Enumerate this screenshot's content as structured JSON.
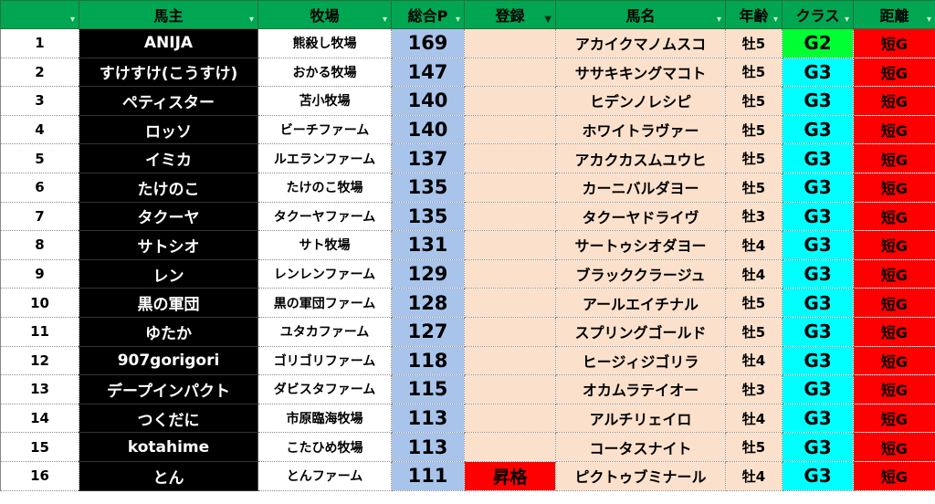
{
  "headers": [
    "",
    "馬主",
    "牧場",
    "総合P",
    "登録",
    "馬名",
    "年齢",
    "クラス",
    "距離"
  ],
  "filter_icon": "▾",
  "filter_active_icon": "▼",
  "rows": [
    {
      "no": "1",
      "owner": "ANIJA",
      "farm": "熊殺し牧場",
      "points": "169",
      "reg": "",
      "horse": "アカイクマノムスコ",
      "age": "牡5",
      "cls": "G2",
      "dist": "短G"
    },
    {
      "no": "2",
      "owner": "すけすけ(こうすけ)",
      "farm": "おかる牧場",
      "points": "147",
      "reg": "",
      "horse": "ササキキングマコト",
      "age": "牡5",
      "cls": "G3",
      "dist": "短G"
    },
    {
      "no": "3",
      "owner": "ペティスター",
      "farm": "苫小牧場",
      "points": "140",
      "reg": "",
      "horse": "ヒデンノレシピ",
      "age": "牡5",
      "cls": "G3",
      "dist": "短G"
    },
    {
      "no": "4",
      "owner": "ロッソ",
      "farm": "ビーチファーム",
      "points": "140",
      "reg": "",
      "horse": "ホワイトラヴァー",
      "age": "牡5",
      "cls": "G3",
      "dist": "短G"
    },
    {
      "no": "5",
      "owner": "イミカ",
      "farm": "ルエランファーム",
      "points": "137",
      "reg": "",
      "horse": "アカクカスムユウヒ",
      "age": "牡5",
      "cls": "G3",
      "dist": "短G"
    },
    {
      "no": "6",
      "owner": "たけのこ",
      "farm": "たけのこ牧場",
      "points": "135",
      "reg": "",
      "horse": "カーニバルダヨー",
      "age": "牡5",
      "cls": "G3",
      "dist": "短G"
    },
    {
      "no": "7",
      "owner": "タクーヤ",
      "farm": "タクーヤファーム",
      "points": "135",
      "reg": "",
      "horse": "タクーヤドライヴ",
      "age": "牡3",
      "cls": "G3",
      "dist": "短G"
    },
    {
      "no": "8",
      "owner": "サトシオ",
      "farm": "サト牧場",
      "points": "131",
      "reg": "",
      "horse": "サートゥシオダヨー",
      "age": "牡4",
      "cls": "G3",
      "dist": "短G"
    },
    {
      "no": "9",
      "owner": "レン",
      "farm": "レンレンファーム",
      "points": "129",
      "reg": "",
      "horse": "ブラッククラージュ",
      "age": "牡4",
      "cls": "G3",
      "dist": "短G"
    },
    {
      "no": "10",
      "owner": "黒の軍団",
      "farm": "黒の軍団ファーム",
      "points": "128",
      "reg": "",
      "horse": "アールエイチナル",
      "age": "牡5",
      "cls": "G3",
      "dist": "短G"
    },
    {
      "no": "11",
      "owner": "ゆたか",
      "farm": "ユタカファーム",
      "points": "127",
      "reg": "",
      "horse": "スプリングゴールド",
      "age": "牡5",
      "cls": "G3",
      "dist": "短G"
    },
    {
      "no": "12",
      "owner": "907gorigori",
      "farm": "ゴリゴリファーム",
      "points": "118",
      "reg": "",
      "horse": "ヒージィジゴリラ",
      "age": "牡4",
      "cls": "G3",
      "dist": "短G"
    },
    {
      "no": "13",
      "owner": "デープインパクト",
      "farm": "ダビスタファーム",
      "points": "115",
      "reg": "",
      "horse": "オカムラテイオー",
      "age": "牡3",
      "cls": "G3",
      "dist": "短G"
    },
    {
      "no": "14",
      "owner": "つくだに",
      "farm": "市原臨海牧場",
      "points": "113",
      "reg": "",
      "horse": "アルチリェイロ",
      "age": "牡4",
      "cls": "G3",
      "dist": "短G"
    },
    {
      "no": "15",
      "owner": "kotahime",
      "farm": "こたひめ牧場",
      "points": "113",
      "reg": "",
      "horse": "コータスナイト",
      "age": "牡5",
      "cls": "G3",
      "dist": "短G"
    },
    {
      "no": "16",
      "owner": "とん",
      "farm": "とんファーム",
      "points": "111",
      "reg": "昇格",
      "horse": "ピクトゥブミナール",
      "age": "牡4",
      "cls": "G3",
      "dist": "短G"
    }
  ]
}
